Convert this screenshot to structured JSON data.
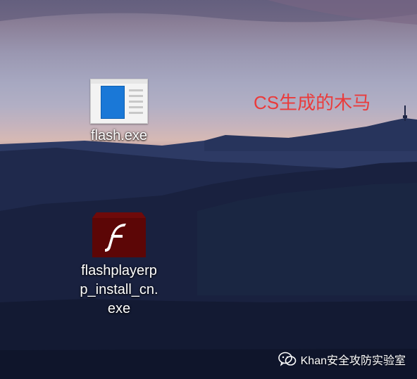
{
  "desktop": {
    "icons": [
      {
        "label": "flash.exe",
        "icon": "exe-window-icon"
      },
      {
        "label": "flashplayerpp_install_cn.exe",
        "label_lines": [
          "flashplayerp",
          "p_install_cn.",
          "exe"
        ],
        "icon": "flash-player-icon"
      }
    ]
  },
  "annotation": {
    "text": "CS生成的木马",
    "color": "#ea3b3b"
  },
  "watermark": {
    "text": "Khan安全攻防实验室",
    "logo": "wechat-official-account-logo"
  },
  "colors": {
    "flash_icon_bg": "#5c0606",
    "exe_icon_accent": "#1a78d7"
  }
}
